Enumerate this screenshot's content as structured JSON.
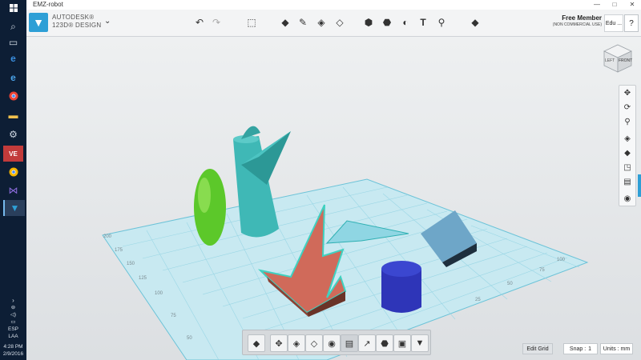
{
  "window": {
    "title": "EMZ-robot"
  },
  "brand": {
    "line1": "AUTODESK®",
    "line2": "123D® DESIGN"
  },
  "account": {
    "member": "Free Member",
    "license": "(NON COMMERCIAL USE)",
    "user": "Edu ...",
    "help": "?"
  },
  "toolbar": {
    "undo": "↶",
    "redo": "↷",
    "text_tool": "T"
  },
  "viewcube": {
    "left_label": "LEFT",
    "front_label": "FRONT"
  },
  "grid": {
    "left_labels": [
      "200",
      "175",
      "150",
      "125",
      "100",
      "75",
      "50"
    ],
    "bottom_labels": [
      "25",
      "50",
      "75",
      "100"
    ]
  },
  "status": {
    "edit_grid": "Edit Grid",
    "snap_label": "Snap :",
    "snap_value": "1",
    "units": "Units : mm"
  },
  "taskbar": {
    "lang1": "ESP",
    "lang2": "LAA",
    "time": "4:28 PM",
    "date": "2/9/2016"
  },
  "colors": {
    "accent": "#2e9fd6",
    "grid": "#8fd3e3",
    "teal": "#3fb8b6",
    "star": "#d06a5a",
    "ellipsoid": "#5cc82a",
    "cylinder": "#2e35b8",
    "cube": "#6ea6c8"
  }
}
